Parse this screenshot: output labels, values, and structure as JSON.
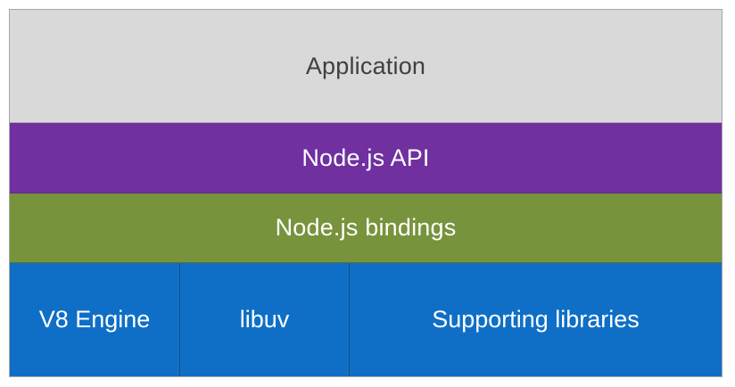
{
  "colors": {
    "application": "#d9d9d9",
    "api": "#7030a0",
    "bindings": "#77933c",
    "base": "#0f6fc6"
  },
  "layers": {
    "application": "Application",
    "api": "Node.js API",
    "bindings": "Node.js bindings"
  },
  "base": {
    "v8": "V8 Engine",
    "libuv": "libuv",
    "supporting": "Supporting libraries"
  }
}
